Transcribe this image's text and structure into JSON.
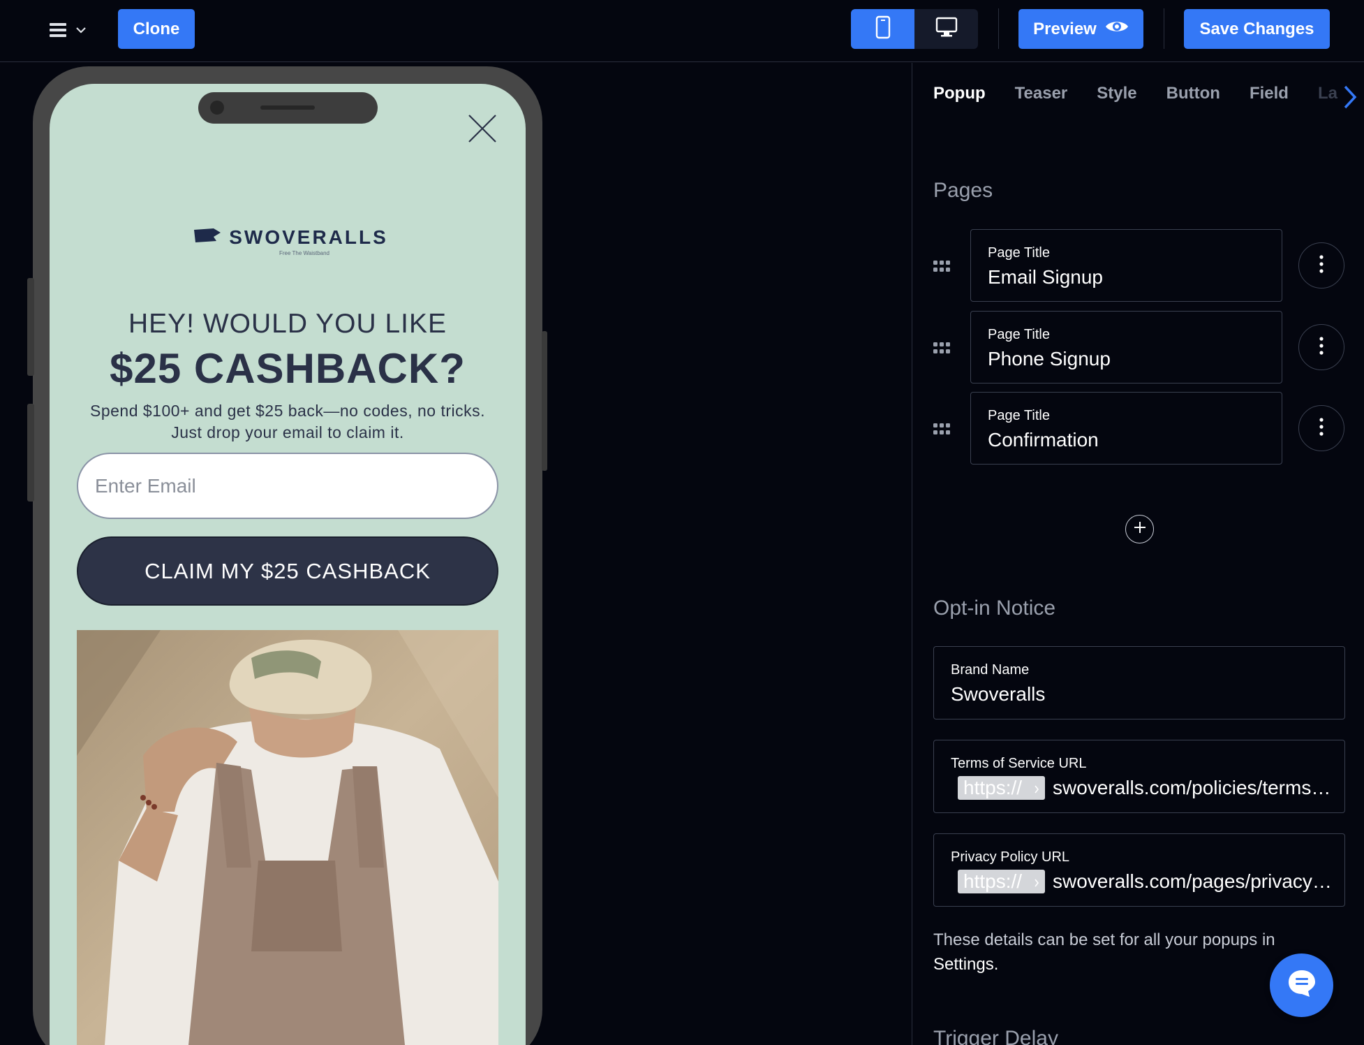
{
  "toolbar": {
    "clone_label": "Clone",
    "preview_label": "Preview",
    "save_label": "Save Changes",
    "active_device": "mobile"
  },
  "popup": {
    "brand_logo_text": "SWOVERALLS",
    "brand_tagline": "Free The Waistband",
    "headline_1": "HEY! WOULD YOU LIKE",
    "headline_2": "$25 CASHBACK?",
    "body_line_1": "Spend $100+ and get $25 back—no codes, no tricks.",
    "body_line_2": "Just drop your email to claim it.",
    "email_placeholder": "Enter Email",
    "cta_label": "CLAIM MY $25 CASHBACK",
    "colors": {
      "background": "#c4ddd0",
      "text": "#2a3147",
      "button": "#2d3347"
    }
  },
  "panel": {
    "tabs": [
      {
        "label": "Popup",
        "active": true
      },
      {
        "label": "Teaser",
        "active": false
      },
      {
        "label": "Style",
        "active": false
      },
      {
        "label": "Button",
        "active": false
      },
      {
        "label": "Field",
        "active": false
      },
      {
        "label": "La",
        "active": false
      }
    ],
    "pages_title": "Pages",
    "pages": [
      {
        "label": "Page Title",
        "value": "Email Signup"
      },
      {
        "label": "Page Title",
        "value": "Phone Signup"
      },
      {
        "label": "Page Title",
        "value": "Confirmation"
      }
    ],
    "optin_title": "Opt-in Notice",
    "brand_name": {
      "label": "Brand Name",
      "value": "Swoveralls"
    },
    "tos_url": {
      "label": "Terms of Service URL",
      "prefix": "https://",
      "value": "swoveralls.com/policies/terms-of-service"
    },
    "privacy_url": {
      "label": "Privacy Policy URL",
      "prefix": "https://",
      "value": "swoveralls.com/pages/privacy-policy"
    },
    "note_text": "These details can be set for all your popups in",
    "note_link": "Settings.",
    "trigger_title": "Trigger Delay"
  },
  "accent_color": "#3478f6"
}
